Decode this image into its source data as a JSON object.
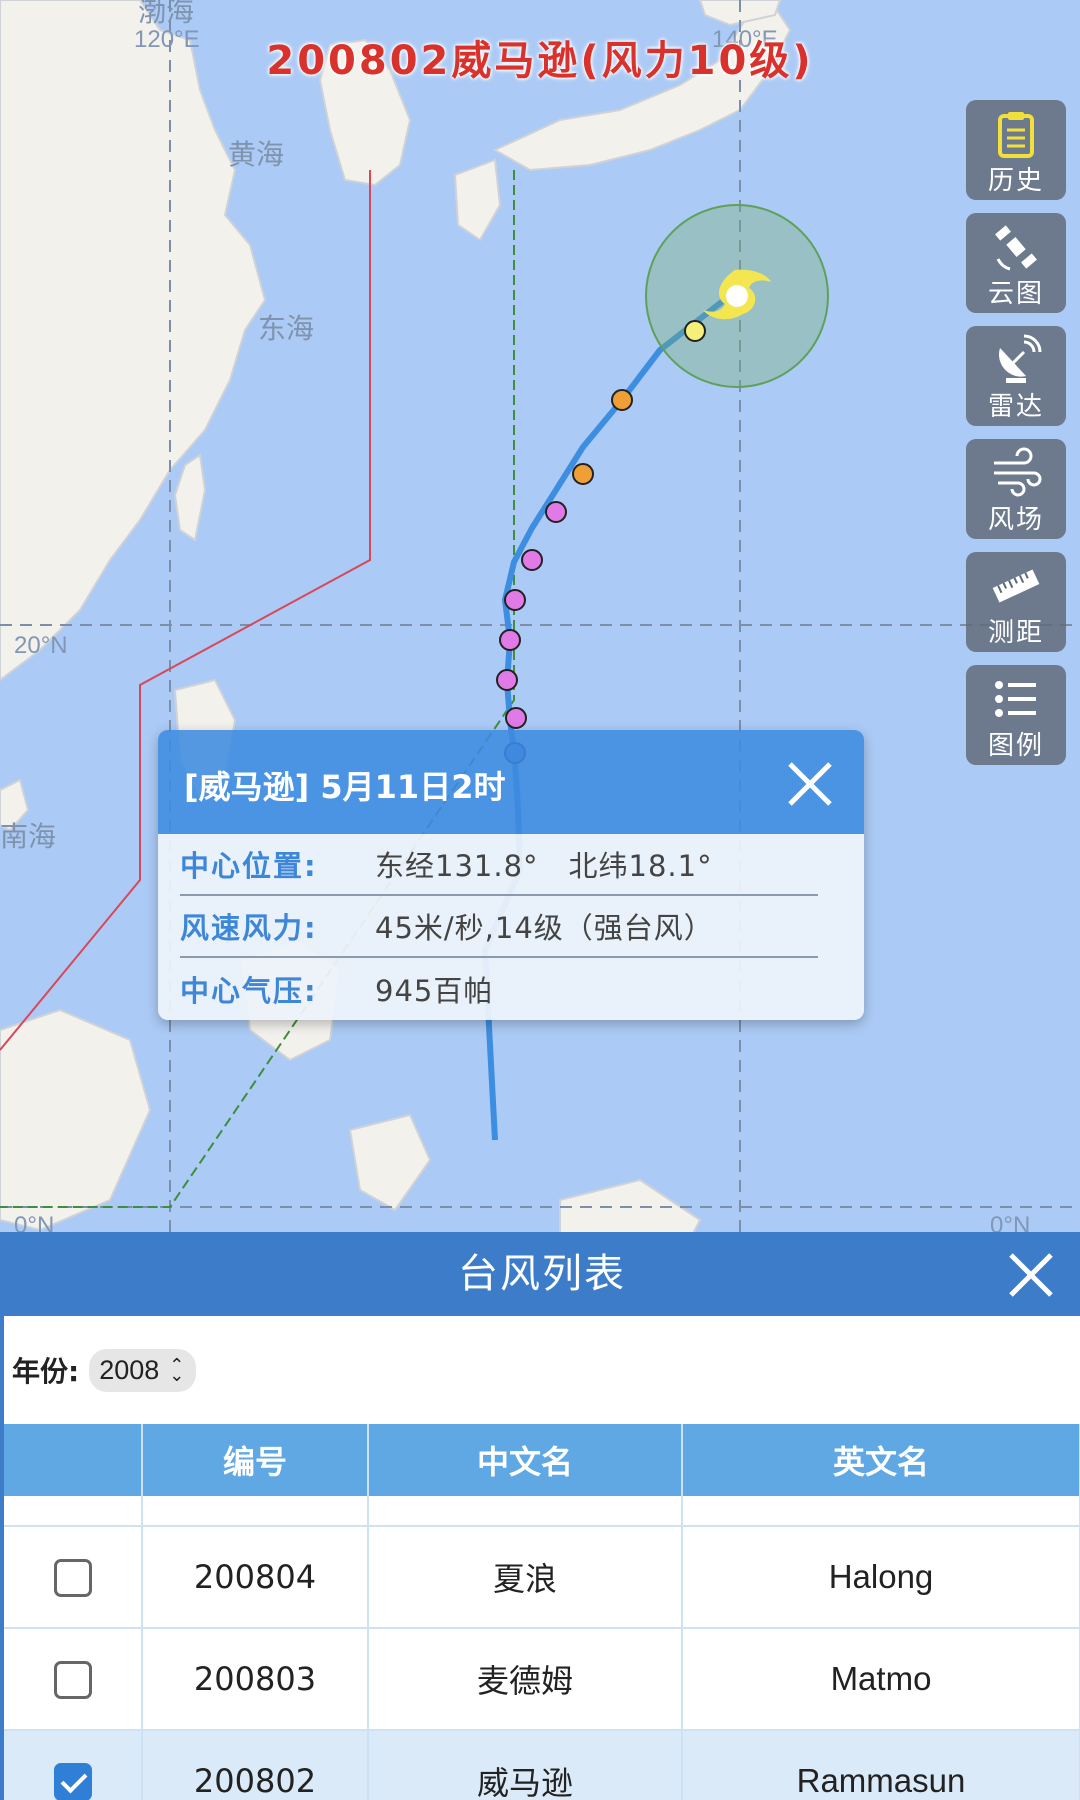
{
  "map": {
    "title": "200802威马逊(风力10级)",
    "place_labels": {
      "bohai": "渤海",
      "yellow_sea": "黄海",
      "east_sea": "东海",
      "south_sea": "南海"
    },
    "grid_labels": {
      "lon_120": "120°E",
      "lon_140": "140°E",
      "lat_20": "20°N",
      "lat_0_left": "0°N",
      "lat_0_right": "0°N"
    },
    "track_point_colors": [
      "#f5f07a",
      "#ef9f36",
      "#ef9f36",
      "#e07ae6",
      "#e07ae6",
      "#e07ae6",
      "#e07ae6",
      "#e07ae6",
      "#e07ae6",
      "#4b7be6"
    ],
    "track_color": "#3d8ee0"
  },
  "toolbar": {
    "items": [
      {
        "label": "历史",
        "icon": "history-clipboard-icon"
      },
      {
        "label": "云图",
        "icon": "satellite-icon"
      },
      {
        "label": "雷达",
        "icon": "radar-dish-icon"
      },
      {
        "label": "风场",
        "icon": "wind-icon"
      },
      {
        "label": "测距",
        "icon": "ruler-icon"
      },
      {
        "label": "图例",
        "icon": "legend-list-icon"
      }
    ]
  },
  "popup": {
    "title": "[威马逊] 5月11日2时",
    "rows": [
      {
        "key": "中心位置:",
        "value": "东经131.8°　北纬18.1°"
      },
      {
        "key": "风速风力:",
        "value": "45米/秒,14级（强台风）"
      },
      {
        "key": "中心气压:",
        "value": "945百帕"
      }
    ]
  },
  "panel": {
    "title": "台风列表",
    "year_label": "年份:",
    "year_value": "2008",
    "columns": [
      "",
      "编号",
      "中文名",
      "英文名"
    ],
    "rows": [
      {
        "checked": false,
        "code": "200804",
        "cn": "夏浪",
        "en": "Halong"
      },
      {
        "checked": false,
        "code": "200803",
        "cn": "麦德姆",
        "en": "Matmo"
      },
      {
        "checked": true,
        "code": "200802",
        "cn": "威马逊",
        "en": "Rammasun"
      }
    ]
  },
  "colors": {
    "panel_header": "#3c7cc8",
    "table_header": "#5fa8e4",
    "popup_header": "#3d8be0",
    "title_red": "#d9312b"
  }
}
